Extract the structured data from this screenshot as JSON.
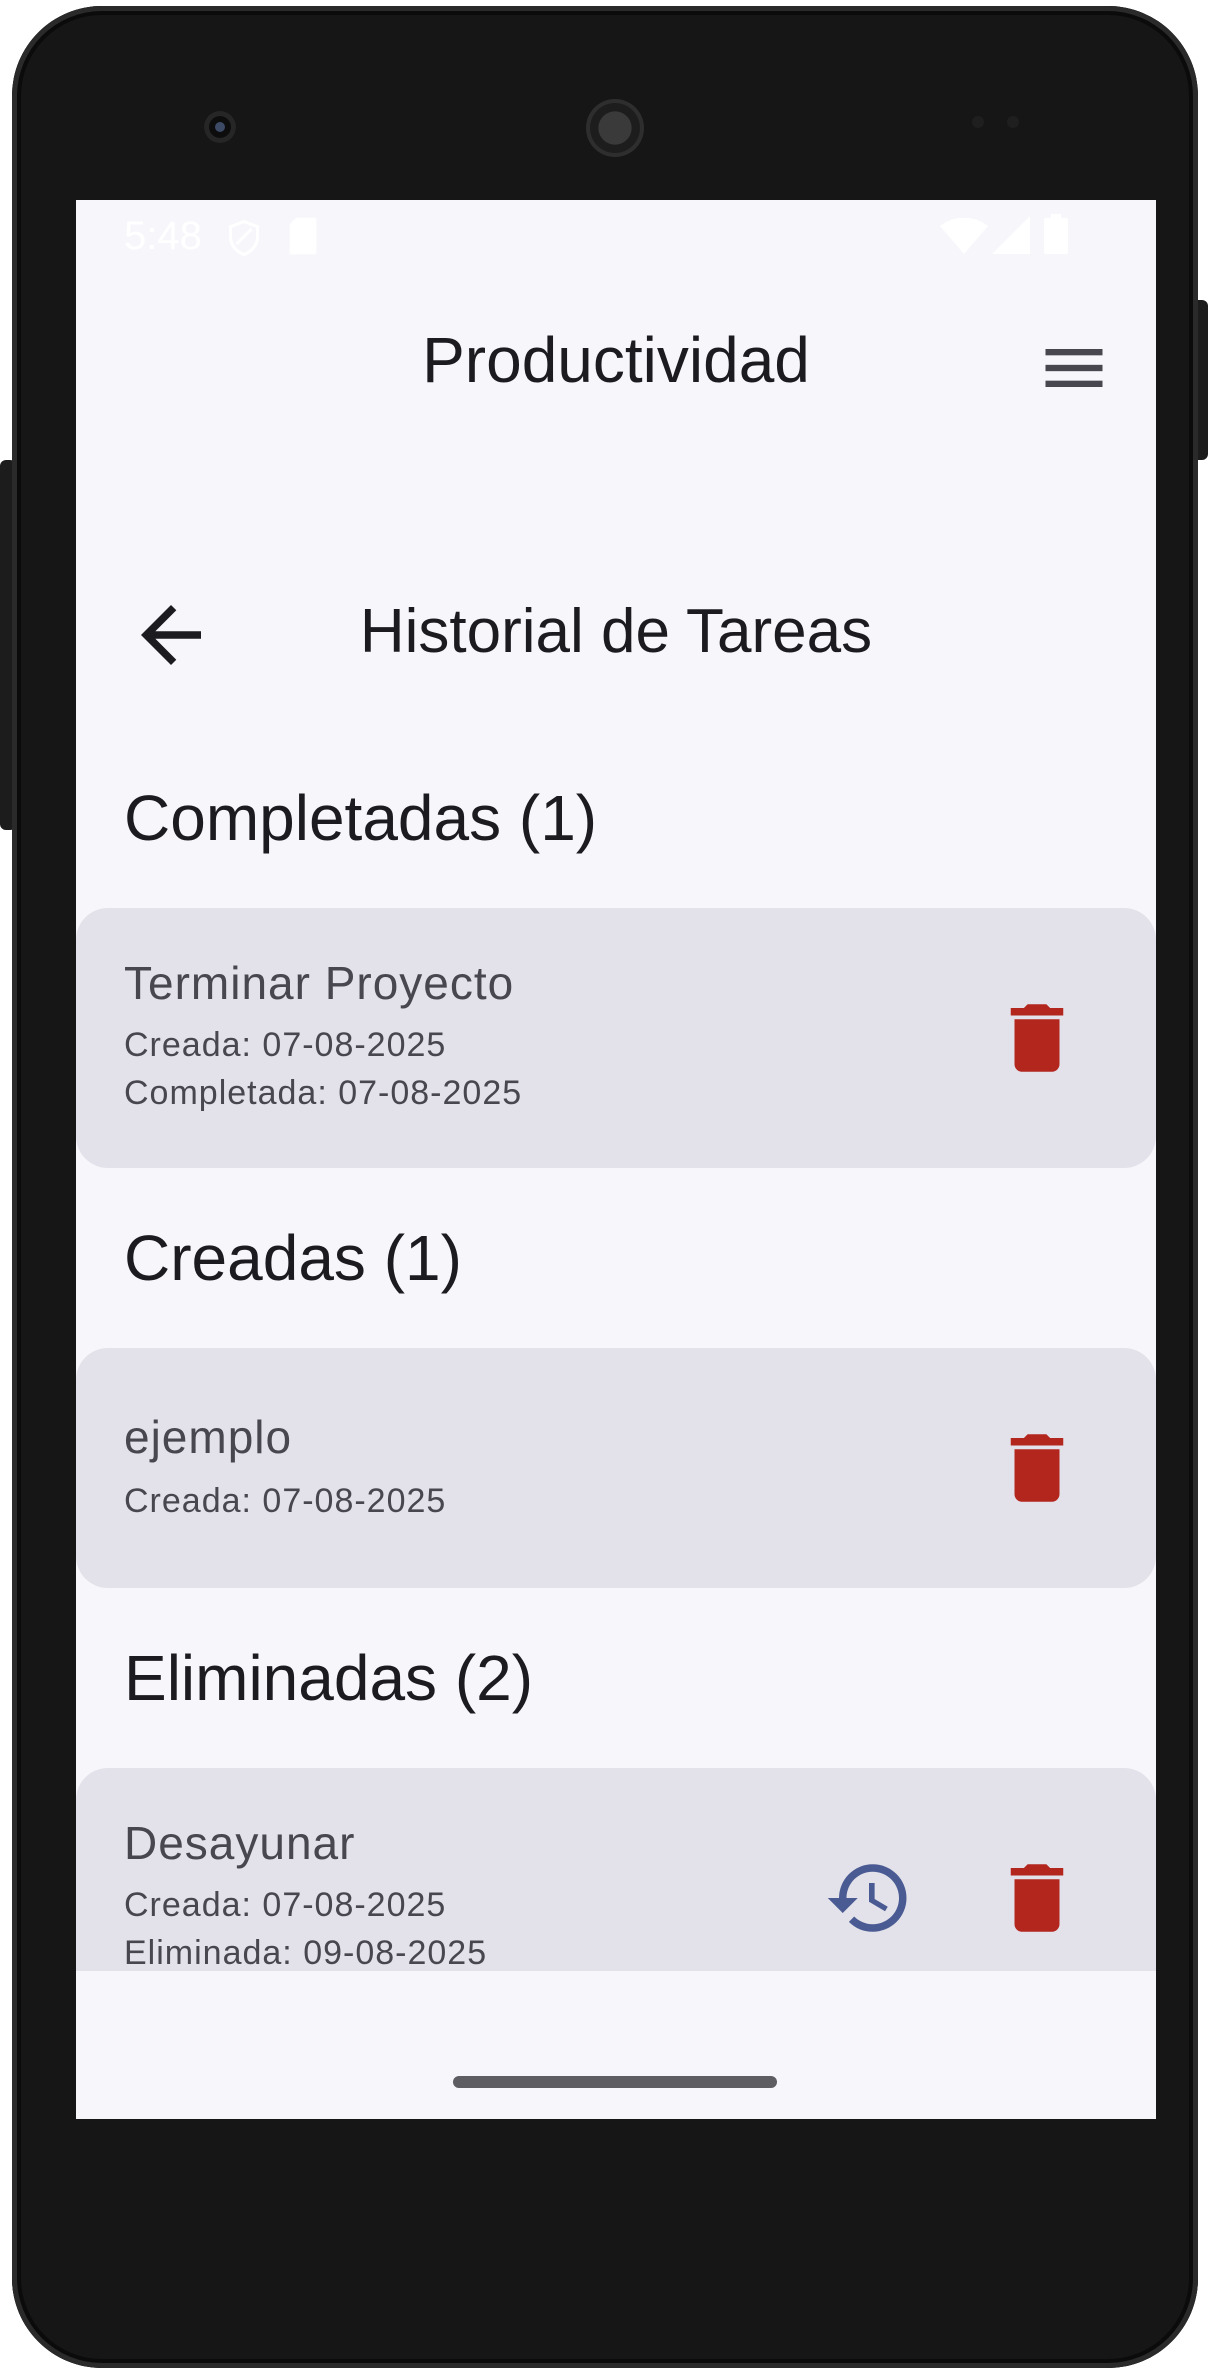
{
  "status_bar": {
    "time": "5:48"
  },
  "app_bar": {
    "title": "Productividad"
  },
  "screen": {
    "title": "Historial de Tareas"
  },
  "sections": {
    "completed": {
      "header": "Completadas (1)",
      "items": [
        {
          "title": "Terminar Proyecto",
          "created": "Creada: 07-08-2025",
          "completed": "Completada: 07-08-2025"
        }
      ]
    },
    "created": {
      "header": "Creadas (1)",
      "items": [
        {
          "title": "ejemplo",
          "created": "Creada: 07-08-2025"
        }
      ]
    },
    "deleted": {
      "header": "Eliminadas (2)",
      "items": [
        {
          "title": "Desayunar",
          "created": "Creada: 07-08-2025",
          "deleted": "Eliminada: 09-08-2025"
        }
      ]
    }
  },
  "icons": {
    "menu": "hamburger-menu-icon",
    "back": "arrow-back-icon",
    "delete": "trash-icon",
    "restore": "history-restore-icon"
  },
  "colors": {
    "background": "#f7f6fb",
    "card": "#e3e2ea",
    "delete": "#b3261e",
    "restore": "#4a5b93"
  }
}
